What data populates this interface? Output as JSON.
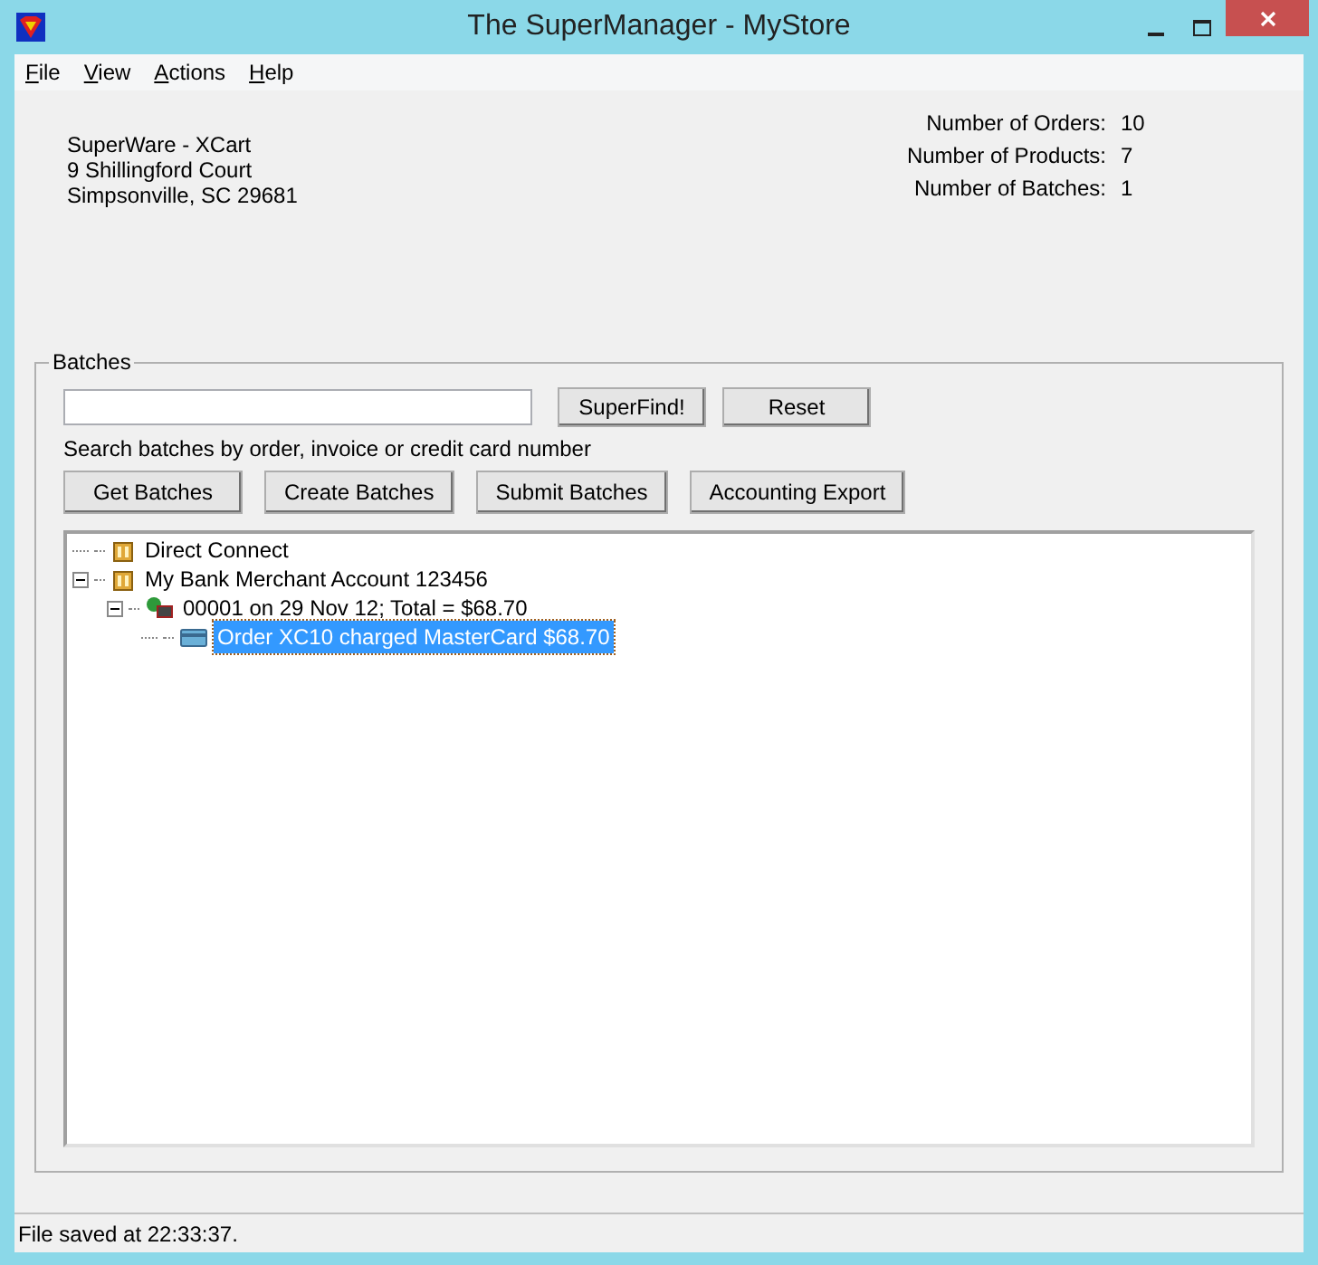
{
  "window": {
    "title": "The SuperManager - MyStore"
  },
  "menu": [
    {
      "label": "File"
    },
    {
      "label": "View"
    },
    {
      "label": "Actions"
    },
    {
      "label": "Help"
    }
  ],
  "address": [
    "SuperWare - XCart",
    "9 Shillingford Court",
    "Simpsonville, SC 29681"
  ],
  "stats": [
    {
      "label": "Number of Orders:",
      "value": "10"
    },
    {
      "label": "Number of Products:",
      "value": "7"
    },
    {
      "label": "Number of Batches:",
      "value": "1"
    }
  ],
  "batches": {
    "title": "Batches",
    "find_button": "SuperFind!",
    "reset_button": "Reset",
    "hint": "Search batches by order, invoice or credit card number",
    "buttons": [
      "Get Batches",
      "Create Batches",
      "Submit Batches",
      "Accounting Export"
    ],
    "tree": [
      {
        "label": "Direct Connect",
        "kind": "bank",
        "selected": false
      },
      {
        "label": "My Bank Merchant Account 123456",
        "kind": "bank",
        "selected": false,
        "expanded": true,
        "children": [
          {
            "label": "00001 on 29 Nov 12; Total = $68.70",
            "kind": "batch",
            "selected": false,
            "expanded": true,
            "children": [
              {
                "label": "Order XC10 charged MasterCard $68.70",
                "kind": "order",
                "selected": true
              }
            ]
          }
        ]
      }
    ]
  },
  "status_bar": "File saved at 22:33:37."
}
